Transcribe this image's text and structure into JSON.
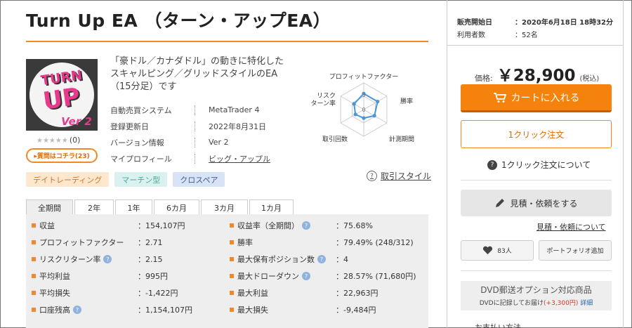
{
  "title": "Turn Up EA （ターン・アップEA）",
  "logo": {
    "line1": "TURN",
    "line2": "UP",
    "line3": "Ver 2"
  },
  "rating": {
    "stars": "★★★★★",
    "count": "(0)"
  },
  "qa_button": "▸質問はコチラ(23)",
  "description": "「豪ドル／カナダドル」の動きに特化したスキャルピング／グリッドスタイルのEA（15分足）です",
  "info": [
    {
      "key": "自動売買システム",
      "value": "MetaTrader 4"
    },
    {
      "key": "登録更新日",
      "value": "2022年8月31日"
    },
    {
      "key": "バージョン情報",
      "value": "Ver 2"
    },
    {
      "key": "マイプロフィール",
      "value": "ビッグ・アップル"
    }
  ],
  "radar": {
    "labels": [
      "プロフィットファクター",
      "勝率",
      "計測期間",
      "取引回数",
      "リスク",
      "ターン率"
    ],
    "scale_labels": [
      "3",
      "0"
    ],
    "values": [
      3,
      3,
      2.3,
      1.6,
      1.8,
      2.1
    ],
    "max": 5,
    "color": "#4a96d6"
  },
  "tags": [
    "デイトレーディング",
    "マーチン型",
    "クロスペア"
  ],
  "trading_style_link": "取引スタイル",
  "tabs": [
    "全期間",
    "2年",
    "1年",
    "6カ月",
    "3カ月",
    "1カ月"
  ],
  "stats_left": [
    {
      "label": "収益",
      "value": "：154,107円",
      "help": false
    },
    {
      "label": "プロフィットファクター",
      "value": "：2.71",
      "help": false
    },
    {
      "label": "リスクリターン率",
      "value": "：2.15",
      "help": true
    },
    {
      "label": "平均利益",
      "value": "：995円",
      "help": false
    },
    {
      "label": "平均損失",
      "value": "：-1,422円",
      "help": false
    },
    {
      "label": "口座残高",
      "value": "：1,154,107円",
      "help": true
    }
  ],
  "stats_right": [
    {
      "label": "収益率（全期間）",
      "value": "：75.68%",
      "help": true
    },
    {
      "label": "勝率",
      "value": "：79.49% (248/312)",
      "help": false
    },
    {
      "label": "最大保有ポジション数",
      "value": "：4",
      "help": true
    },
    {
      "label": "最大ドローダウン",
      "value": "：28.57% (71,680円)",
      "help": true
    },
    {
      "label": "最大利益",
      "value": "：22,963円",
      "help": false
    },
    {
      "label": "最大損失",
      "value": "：-9,484円",
      "help": false
    }
  ],
  "help_glyph": "?",
  "sidebar": {
    "sale_start_label": "販売開始日",
    "sale_start_value": "：2020年6月18日 18時32分",
    "users_label": "利用者数",
    "users_value": "：52名",
    "price_label": "価格:",
    "price": "￥28,900",
    "tax": "(税込)",
    "cart_button": "カートに入れる",
    "one_click_button": "1クリック注文",
    "about_one_click": "1クリック注文について",
    "quote_button": "見積・依頼をする",
    "quote_link": "見積・依頼について",
    "favorites_count": "83人",
    "portfolio_button": "ポートフォリオ追加",
    "dvd_title": "DVD郵送オプション対応商品",
    "dvd_note": "DVDに記録してお届け",
    "dvd_price": "(+3,300円)",
    "dvd_details": "詳細",
    "cutoff_text": "お支払い方法"
  },
  "colors": {
    "accent": "#f08a24",
    "cart": "#f5820d",
    "radar": "#4a96d6"
  }
}
